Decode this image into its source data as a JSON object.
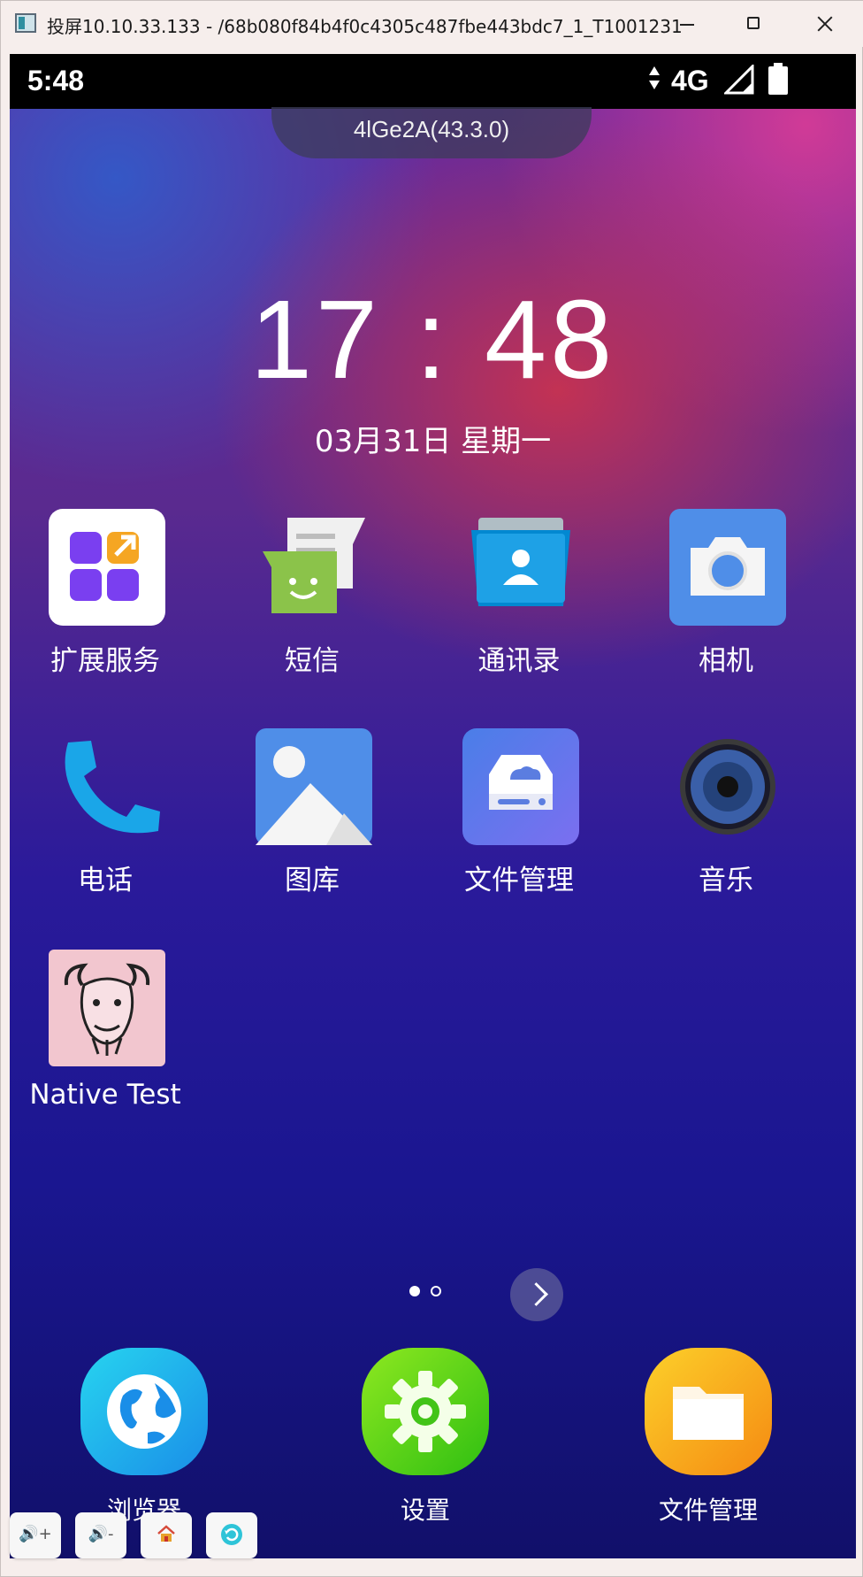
{
  "window": {
    "title": "投屏10.10.33.133 - /68b080f84b4f0c4305c487fbe443bdc7_1_T1001231"
  },
  "status_bar": {
    "time": "5:48",
    "network": "4G"
  },
  "top_tab": {
    "label": "4lGe2A(43.3.0)"
  },
  "lockclock": {
    "time": "17 : 48",
    "date": "03月31日   星期一"
  },
  "apps": [
    {
      "label": "扩展服务",
      "icon": "extension-service-icon"
    },
    {
      "label": "短信",
      "icon": "messaging-icon"
    },
    {
      "label": "通讯录",
      "icon": "contacts-icon"
    },
    {
      "label": "相机",
      "icon": "camera-icon"
    },
    {
      "label": "电话",
      "icon": "phone-icon"
    },
    {
      "label": "图库",
      "icon": "gallery-icon"
    },
    {
      "label": "文件管理",
      "icon": "file-manager-icon"
    },
    {
      "label": "音乐",
      "icon": "music-icon"
    },
    {
      "label": "Native Test",
      "icon": "gnu-icon"
    }
  ],
  "pager": {
    "pages": 2,
    "current": 1
  },
  "dock": [
    {
      "label": "浏览器",
      "icon": "browser-icon"
    },
    {
      "label": "设置",
      "icon": "settings-icon"
    },
    {
      "label": "文件管理",
      "icon": "files-icon"
    }
  ],
  "tools": [
    {
      "label": "🔊+",
      "icon": "volume-up-icon"
    },
    {
      "label": "🔊-",
      "icon": "volume-down-icon"
    },
    {
      "label": "",
      "icon": "home-icon"
    },
    {
      "label": "",
      "icon": "rotate-icon"
    }
  ],
  "colors": {
    "camera_bg": "#4f8ee8",
    "gallery_bg": "#4f8ee8",
    "files_bg": "#5b7de0",
    "gnu_bg": "#f2c6cf",
    "browser_bg": "#1fa8e8",
    "settings_bg": "#5cd21a",
    "dock_files_bg": "#f7a21b"
  }
}
